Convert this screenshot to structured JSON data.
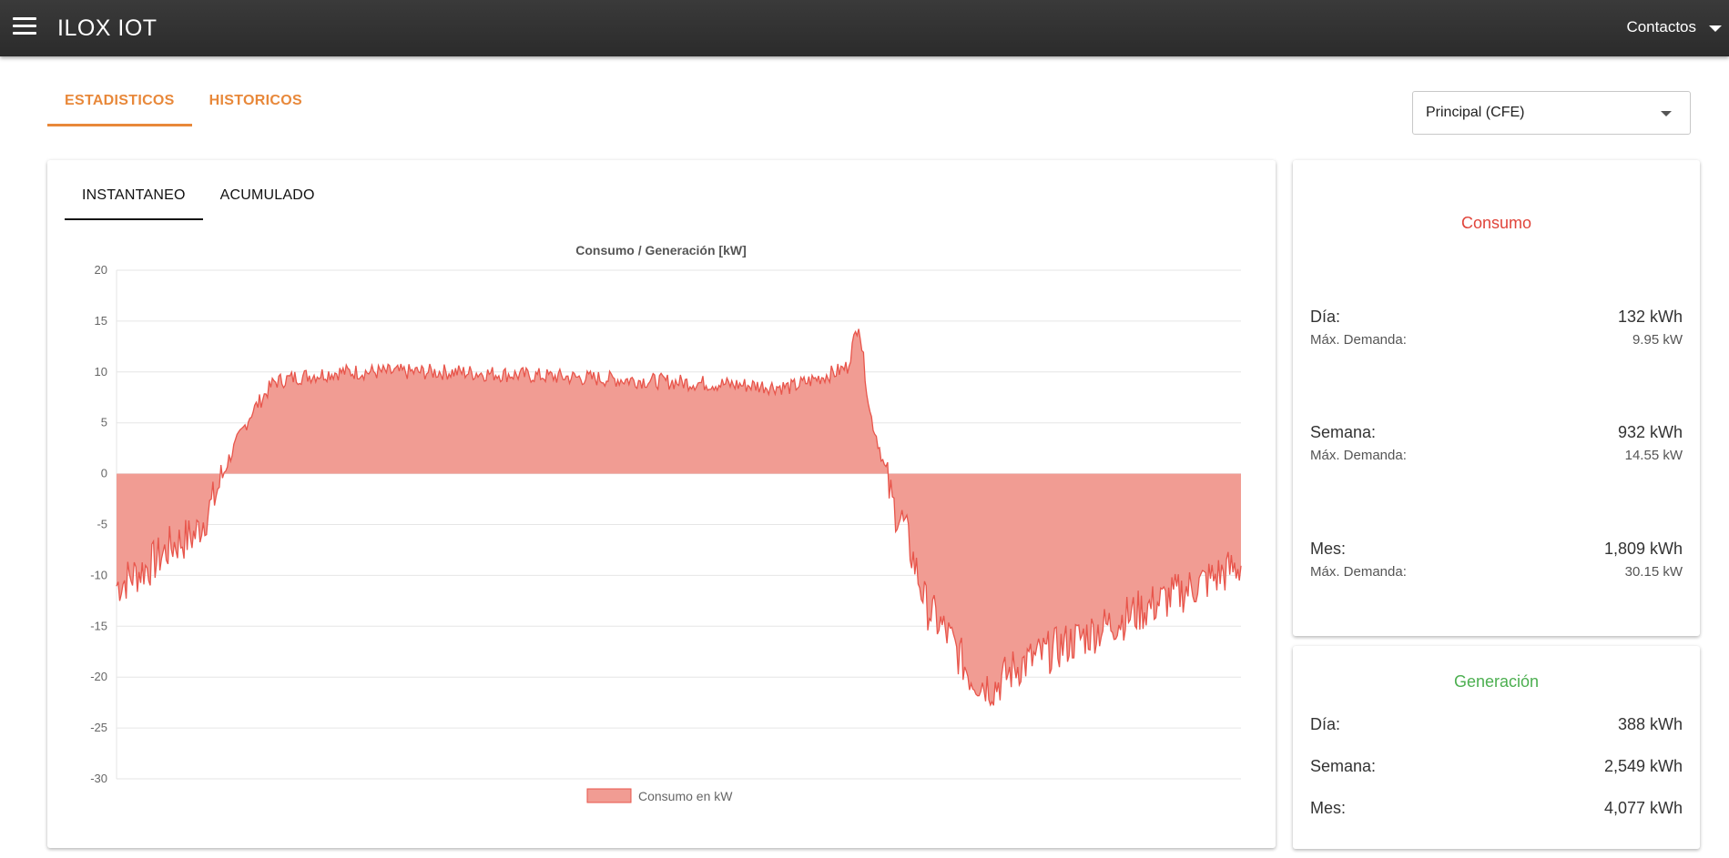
{
  "appbar": {
    "title": "ILOX IOT",
    "contacts_label": "Contactos"
  },
  "main_tabs": [
    {
      "label": "ESTADISTICOS"
    },
    {
      "label": "HISTORICOS"
    }
  ],
  "selector": {
    "value": "Principal (CFE)"
  },
  "sub_tabs": [
    {
      "label": "INSTANTANEO"
    },
    {
      "label": "ACUMULADO"
    }
  ],
  "colors": {
    "accent": "#e8883a",
    "consumo_title": "#e0443a",
    "generacion_title": "#4caf50",
    "series_line": "#e8554b",
    "series_fill": "#f19c93"
  },
  "chart_data": {
    "type": "area",
    "title": "Consumo / Generación [kW]",
    "ylim": [
      -30,
      20
    ],
    "yticks": [
      "20",
      "15",
      "10",
      "5",
      "0",
      "-5",
      "-10",
      "-15",
      "-20",
      "-25",
      "-30"
    ],
    "legend_position": "bottom",
    "grid": true,
    "series": [
      {
        "name": "Consumo en kW",
        "x": [
          0,
          0.03,
          0.05,
          0.07,
          0.085,
          0.1,
          0.12,
          0.14,
          0.16,
          0.2,
          0.3,
          0.4,
          0.5,
          0.6,
          0.64,
          0.65,
          0.66,
          0.67,
          0.68,
          0.69,
          0.7,
          0.71,
          0.72,
          0.74,
          0.76,
          0.78,
          0.8,
          0.82,
          0.84,
          0.86,
          0.88,
          0.9,
          0.92,
          0.94,
          0.96,
          0.98,
          1.0
        ],
        "y": [
          -11,
          -9,
          -7,
          -6,
          -3,
          1.5,
          6,
          9,
          9.5,
          10,
          10,
          9.5,
          9,
          8.5,
          10,
          10.5,
          15,
          6,
          2,
          -3,
          -5,
          -9,
          -13,
          -16,
          -20,
          -21,
          -19,
          -18,
          -17,
          -16,
          -15,
          -14,
          -13,
          -12,
          -11,
          -10,
          -9
        ]
      }
    ]
  },
  "consumo": {
    "title": "Consumo",
    "rows": [
      {
        "label": "Día:",
        "value": "132 kWh",
        "sub_label": "Máx. Demanda:",
        "sub_value": "9.95 kW"
      },
      {
        "label": "Semana:",
        "value": "932 kWh",
        "sub_label": "Máx. Demanda:",
        "sub_value": "14.55 kW"
      },
      {
        "label": "Mes:",
        "value": "1,809 kWh",
        "sub_label": "Máx. Demanda:",
        "sub_value": "30.15 kW"
      }
    ]
  },
  "generacion": {
    "title": "Generación",
    "rows": [
      {
        "label": "Día:",
        "value": "388 kWh"
      },
      {
        "label": "Semana:",
        "value": "2,549 kWh"
      },
      {
        "label": "Mes:",
        "value": "4,077 kWh"
      }
    ]
  }
}
